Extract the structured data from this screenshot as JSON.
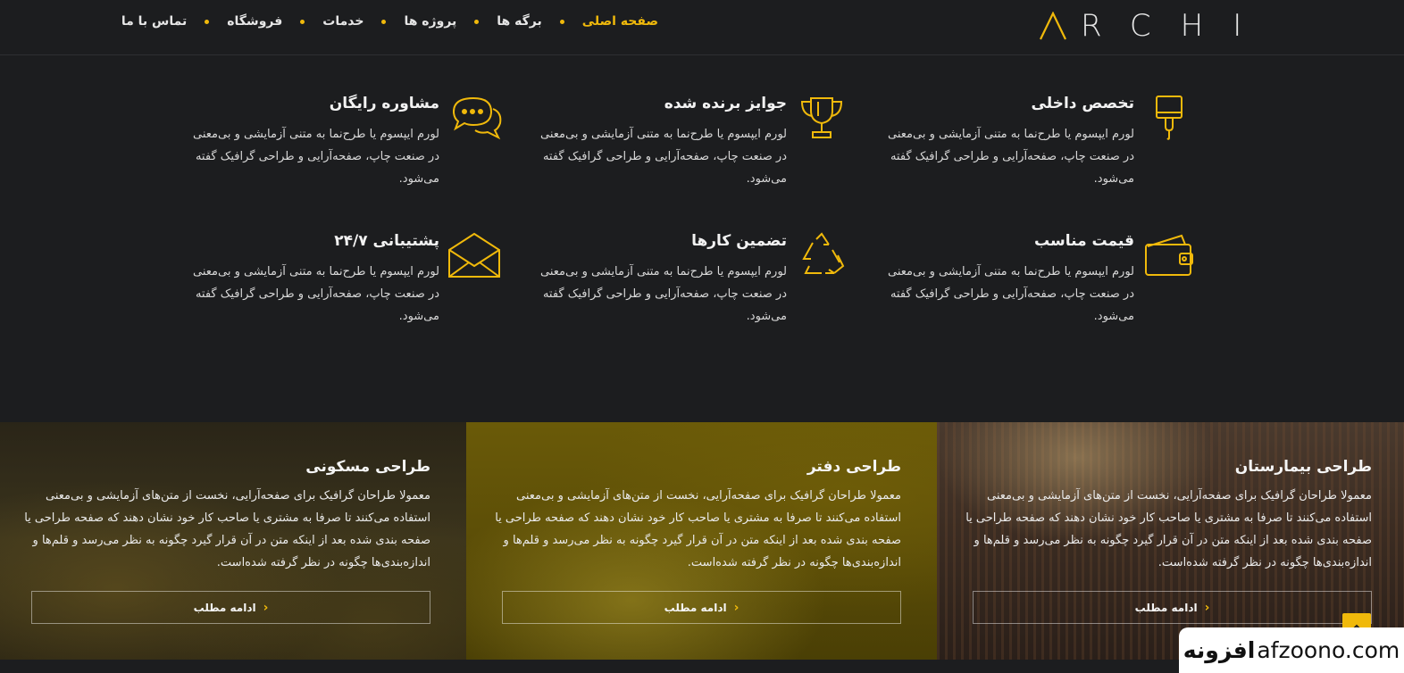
{
  "header": {
    "logo_text": "RCHI",
    "nav": [
      {
        "label": "صفحه اصلی",
        "active": true
      },
      {
        "label": "برگه ها",
        "active": false
      },
      {
        "label": "پروژه ها",
        "active": false
      },
      {
        "label": "خدمات",
        "active": false
      },
      {
        "label": "فروشگاه",
        "active": false
      },
      {
        "label": "تماس با ما",
        "active": false
      }
    ]
  },
  "features": [
    {
      "title": "تخصص داخلی",
      "icon": "paint-brush-icon",
      "text": "لورم ایپسوم یا طرح‌نما به متنی آزمایشی و بی‌معنی در صنعت چاپ، صفحه‌آرایی و طراحی گرافیک گفته می‌شود."
    },
    {
      "title": "جوایز برنده شده",
      "icon": "trophy-icon",
      "text": "لورم ایپسوم یا طرح‌نما به متنی آزمایشی و بی‌معنی در صنعت چاپ، صفحه‌آرایی و طراحی گرافیک گفته می‌شود."
    },
    {
      "title": "مشاوره رایگان",
      "icon": "chat-bubbles-icon",
      "text": "لورم ایپسوم یا طرح‌نما به متنی آزمایشی و بی‌معنی در صنعت چاپ، صفحه‌آرایی و طراحی گرافیک گفته می‌شود."
    },
    {
      "title": "قیمت مناسب",
      "icon": "wallet-icon",
      "text": "لورم ایپسوم یا طرح‌نما به متنی آزمایشی و بی‌معنی در صنعت چاپ، صفحه‌آرایی و طراحی گرافیک گفته می‌شود."
    },
    {
      "title": "تضمین کارها",
      "icon": "recycle-icon",
      "text": "لورم ایپسوم یا طرح‌نما به متنی آزمایشی و بی‌معنی در صنعت چاپ، صفحه‌آرایی و طراحی گرافیک گفته می‌شود."
    },
    {
      "title": "پشتیبانی ۲۴/۷",
      "icon": "envelope-icon",
      "text": "لورم ایپسوم یا طرح‌نما به متنی آزمایشی و بی‌معنی در صنعت چاپ، صفحه‌آرایی و طراحی گرافیک گفته می‌شود."
    }
  ],
  "services": [
    {
      "title": "طراحی بیمارستان",
      "text": "معمولا طراحان گرافیک برای صفحه‌آرایی، نخست از متن‌های آزمایشی و بی‌معنی استفاده می‌کنند تا صرفا به مشتری یا صاحب کار خود نشان دهند که صفحه طراحی یا صفحه بندی شده بعد از اینکه متن در آن قرار گیرد چگونه به نظر می‌رسد و قلم‌ها و اندازه‌بندی‌ها چگونه در نظر گرفته شده‌است.",
      "button": "ادامه مطلب"
    },
    {
      "title": "طراحی دفتر",
      "text": "معمولا طراحان گرافیک برای صفحه‌آرایی، نخست از متن‌های آزمایشی و بی‌معنی استفاده می‌کنند تا صرفا به مشتری یا صاحب کار خود نشان دهند که صفحه طراحی یا صفحه بندی شده بعد از اینکه متن در آن قرار گیرد چگونه به نظر می‌رسد و قلم‌ها و اندازه‌بندی‌ها چگونه در نظر گرفته شده‌است.",
      "button": "ادامه مطلب"
    },
    {
      "title": "طراحی مسکونی",
      "text": "معمولا طراحان گرافیک برای صفحه‌آرایی، نخست از متن‌های آزمایشی و بی‌معنی استفاده می‌کنند تا صرفا به مشتری یا صاحب کار خود نشان دهند که صفحه طراحی یا صفحه بندی شده بعد از اینکه متن در آن قرار گیرد چگونه به نظر می‌رسد و قلم‌ها و اندازه‌بندی‌ها چگونه در نظر گرفته شده‌است.",
      "button": "ادامه مطلب"
    }
  ],
  "scroll_top_icon": "chevron-up-icon",
  "watermark": {
    "fa": "افزونه",
    "en": "afzoono.com"
  },
  "colors": {
    "accent": "#f0b90b",
    "background": "#1c1d1f"
  }
}
